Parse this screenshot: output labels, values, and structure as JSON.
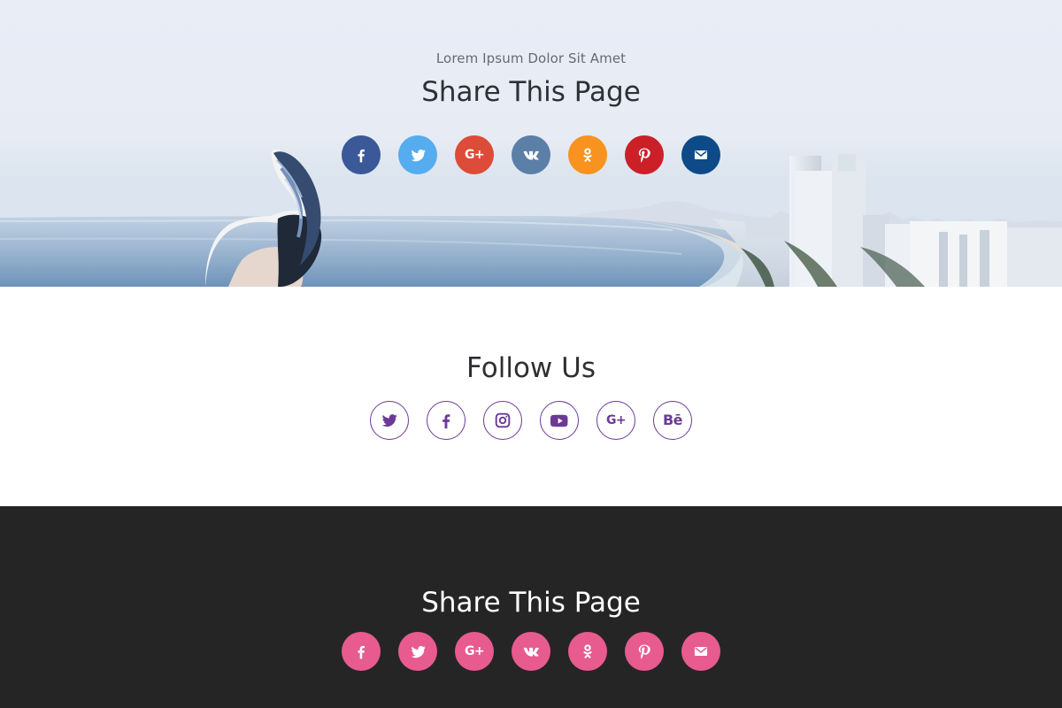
{
  "hero": {
    "subtitle": "Lorem Ipsum Dolor Sit Amet",
    "title": "Share This Page",
    "share_buttons": [
      {
        "icon": "facebook-icon",
        "color": "#3b5998"
      },
      {
        "icon": "twitter-icon",
        "color": "#55acee"
      },
      {
        "icon": "google-plus-icon",
        "color": "#dd4b39"
      },
      {
        "icon": "vk-icon",
        "color": "#5b7fa6"
      },
      {
        "icon": "odnoklassniki-icon",
        "color": "#f7931e"
      },
      {
        "icon": "pinterest-icon",
        "color": "#cb2027"
      },
      {
        "icon": "email-icon",
        "color": "#0e4a88"
      }
    ]
  },
  "follow": {
    "title": "Follow Us",
    "accent": "#6c3a95",
    "buttons": [
      {
        "icon": "twitter-icon"
      },
      {
        "icon": "facebook-icon"
      },
      {
        "icon": "instagram-icon"
      },
      {
        "icon": "youtube-icon"
      },
      {
        "icon": "google-plus-icon"
      },
      {
        "icon": "behance-icon"
      }
    ]
  },
  "footer": {
    "title": "Share This Page",
    "background": "#252525",
    "button_color": "#e75b8f",
    "share_buttons": [
      {
        "icon": "facebook-icon"
      },
      {
        "icon": "twitter-icon"
      },
      {
        "icon": "google-plus-icon"
      },
      {
        "icon": "vk-icon"
      },
      {
        "icon": "odnoklassniki-icon"
      },
      {
        "icon": "pinterest-icon"
      },
      {
        "icon": "email-icon"
      }
    ]
  }
}
